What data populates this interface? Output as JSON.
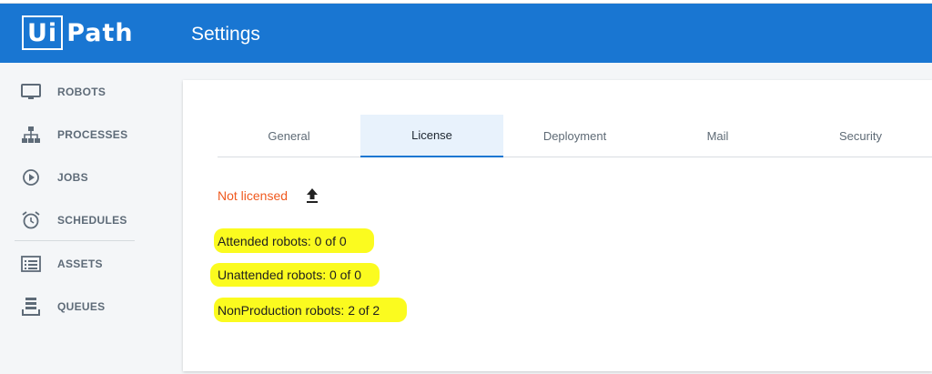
{
  "header": {
    "logo_prefix": "Ui",
    "logo_suffix": "Path",
    "title": "Settings"
  },
  "sidebar": {
    "items": [
      {
        "label": "ROBOTS",
        "icon": "monitor-icon"
      },
      {
        "label": "PROCESSES",
        "icon": "hierarchy-icon"
      },
      {
        "label": "JOBS",
        "icon": "play-circle-icon"
      },
      {
        "label": "SCHEDULES",
        "icon": "alarm-clock-icon"
      },
      {
        "label": "ASSETS",
        "icon": "list-card-icon"
      },
      {
        "label": "QUEUES",
        "icon": "queue-stack-icon"
      }
    ]
  },
  "tabs": [
    {
      "label": "General",
      "active": false
    },
    {
      "label": "License",
      "active": true
    },
    {
      "label": "Deployment",
      "active": false
    },
    {
      "label": "Mail",
      "active": false
    },
    {
      "label": "Security",
      "active": false
    }
  ],
  "license": {
    "status": "Not licensed",
    "upload_icon": "upload-icon",
    "attended": "Attended robots: 0 of 0",
    "unattended": "Unattended robots: 0 of 0",
    "nonproduction": "NonProduction robots: 2 of 2"
  },
  "colors": {
    "brand": "#1976d2",
    "status_warning": "#f0591e",
    "highlight": "#fbfb1f"
  }
}
